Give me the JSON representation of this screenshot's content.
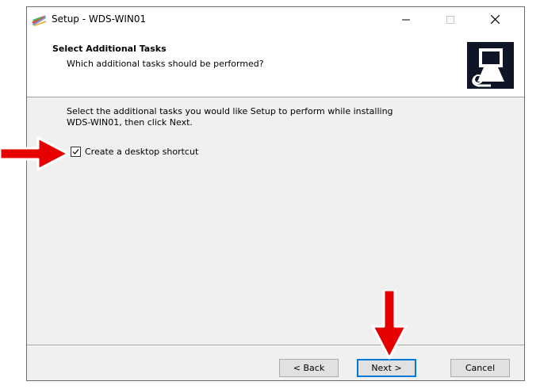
{
  "window": {
    "title": "Setup - WDS-WIN01"
  },
  "header": {
    "title": "Select Additional Tasks",
    "subtitle": "Which additional tasks should be performed?"
  },
  "content": {
    "intro_line1": "Select the additional tasks you would like Setup to perform while installing",
    "intro_line2": "WDS-WIN01, then click Next.",
    "checkbox_label": "Create a desktop shortcut",
    "checkbox_checked": true
  },
  "buttons": {
    "back": "< Back",
    "next": "Next >",
    "cancel": "Cancel"
  },
  "icons": {
    "app": "setup-app-icon",
    "header": "computer-install-icon",
    "minimize": "minimize-icon",
    "maximize": "maximize-icon",
    "close": "close-icon"
  },
  "annotations": {
    "arrow_color": "#e60000"
  }
}
